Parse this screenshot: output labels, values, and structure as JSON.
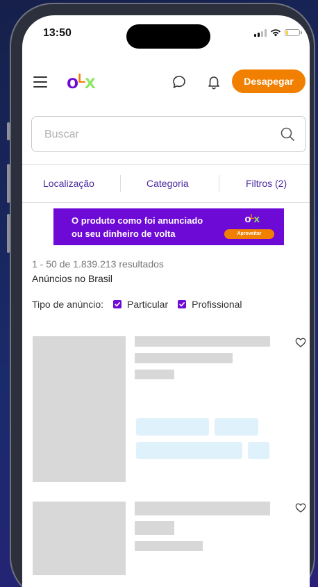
{
  "status_bar": {
    "time": "13:50",
    "battery_level": 0.2
  },
  "header": {
    "logo": {
      "o": "o",
      "l": "L",
      "x": "x"
    },
    "menu_icon": "hamburger-icon",
    "chat_icon": "chat-bubble-icon",
    "notification_icon": "bell-icon",
    "cta_label": "Desapegar"
  },
  "search": {
    "placeholder": "Buscar",
    "value": "",
    "icon": "search-icon"
  },
  "filters": {
    "location": "Localização",
    "category": "Categoria",
    "filters": "Filtros (2)"
  },
  "banner": {
    "line1": "O produto como foi anunciado",
    "line2": "ou seu dinheiro de volta",
    "logo": {
      "o": "o",
      "l": "L",
      "x": "x"
    },
    "button_label": "Aproveitar"
  },
  "results": {
    "count": "1 - 50 de 1.839.213 resultados",
    "region": "Anúncios no Brasil"
  },
  "ad_type": {
    "label": "Tipo de anúncio:",
    "options": [
      {
        "label": "Particular",
        "checked": true
      },
      {
        "label": "Profissional",
        "checked": true
      }
    ]
  },
  "colors": {
    "brand_purple": "#6e0ad6",
    "brand_orange": "#f28000",
    "brand_green": "#8ce563",
    "skeleton_gray": "#d8d8d8",
    "skeleton_blue": "#dff2fb"
  }
}
